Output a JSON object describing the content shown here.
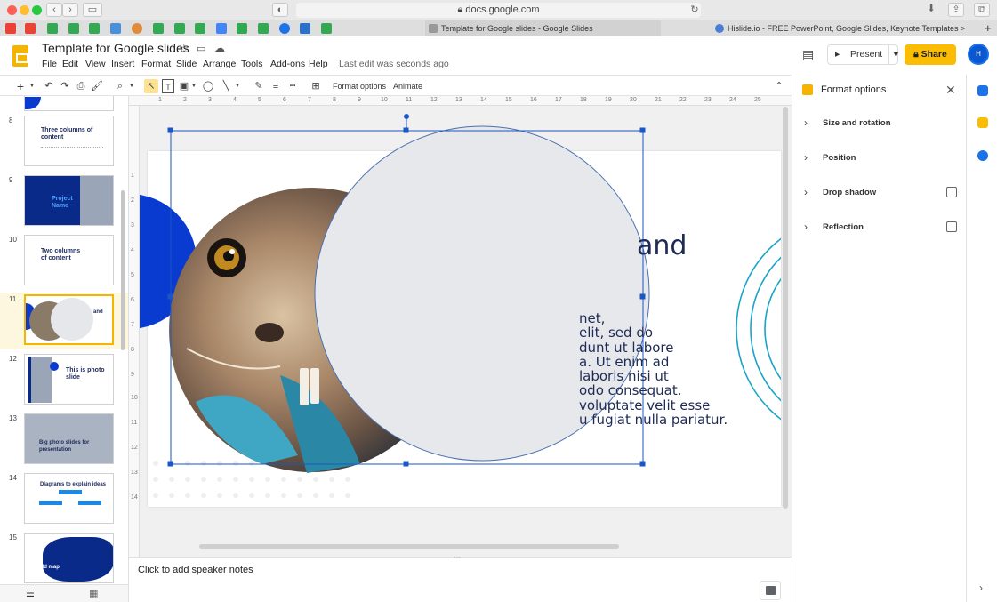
{
  "browser": {
    "url": "docs.google.com",
    "tabs": [
      {
        "label": "Template for Google slides - Google Slides"
      },
      {
        "label": "Hislide.io - FREE PowerPoint, Google Slides, Keynote Templates >"
      }
    ]
  },
  "header": {
    "doc_title": "Template for Google slides",
    "menus": [
      "File",
      "Edit",
      "View",
      "Insert",
      "Format",
      "Slide",
      "Arrange",
      "Tools",
      "Add-ons",
      "Help"
    ],
    "last_edit": "Last edit was seconds ago",
    "present_label": "Present",
    "share_label": "Share",
    "avatar_initials": "H"
  },
  "toolbar": {
    "format_options_label": "Format options",
    "animate_label": "Animate"
  },
  "filmstrip": {
    "slides": [
      {
        "num": "8",
        "title": "Three columns of content"
      },
      {
        "num": "9",
        "title": "Project Name"
      },
      {
        "num": "10",
        "title": "Two columns of content"
      },
      {
        "num": "11",
        "title": "and"
      },
      {
        "num": "12",
        "title": "This is photo slide"
      },
      {
        "num": "13",
        "title": "Big photo slides for presentation"
      },
      {
        "num": "14",
        "title": "Diagrams to explain ideas"
      },
      {
        "num": "15",
        "title": "World map"
      }
    ]
  },
  "ruler": {
    "top_ticks": [
      "1",
      "2",
      "3",
      "4",
      "5",
      "6",
      "7",
      "8",
      "9",
      "10",
      "11",
      "12",
      "13",
      "14",
      "15",
      "16",
      "17",
      "18",
      "19",
      "20",
      "21",
      "22",
      "23",
      "24",
      "25"
    ],
    "left_ticks": [
      "1",
      "2",
      "3",
      "4",
      "5",
      "6",
      "7",
      "8",
      "9",
      "10",
      "11",
      "12",
      "13",
      "14"
    ]
  },
  "slide": {
    "title_fragment": "and",
    "body_text": "net,\nelit, sed do\ndunt ut labore\na. Ut enim ad\nlaboris nisi ut\nodo consequat.\nvoluptate velit esse\nu fugiat nulla pariatur."
  },
  "notes": {
    "placeholder": "Click to add speaker notes"
  },
  "format_panel": {
    "title": "Format options",
    "sections": [
      {
        "label": "Size and rotation"
      },
      {
        "label": "Position"
      },
      {
        "label": "Drop shadow"
      },
      {
        "label": "Reflection"
      }
    ]
  },
  "colors": {
    "accent_yellow": "#fbbc04",
    "slide_blue": "#0a3bd0",
    "dark_navy": "#1f2b55",
    "selection_blue": "#1a56c4"
  }
}
